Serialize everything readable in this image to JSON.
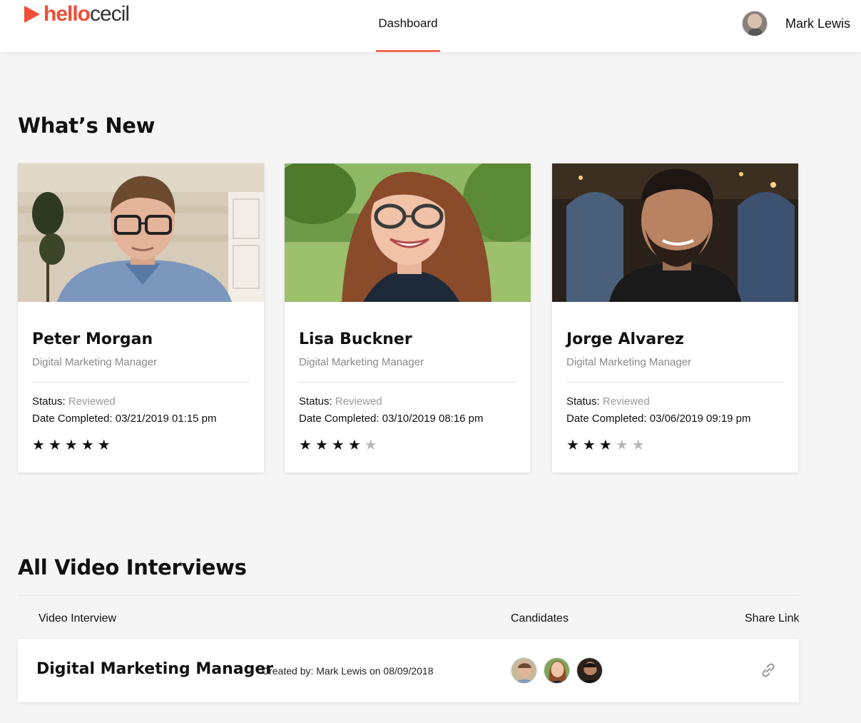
{
  "app": {
    "logo_hello": "hello",
    "logo_cecil": "cecil"
  },
  "nav": {
    "active_tab": "Dashboard"
  },
  "user": {
    "name": "Mark Lewis"
  },
  "whats_new": {
    "title": "What’s New",
    "status_label": "Status:",
    "date_label": "Date Completed:",
    "cards": [
      {
        "name": "Peter Morgan",
        "role": "Digital Marketing Manager",
        "status": "Reviewed",
        "date": "03/21/2019 01:15 pm",
        "rating": 5,
        "rating_max": 5
      },
      {
        "name": "Lisa Buckner",
        "role": "Digital Marketing Manager",
        "status": "Reviewed",
        "date": "03/10/2019 08:16 pm",
        "rating": 4,
        "rating_max": 5
      },
      {
        "name": "Jorge Alvarez",
        "role": "Digital Marketing Manager",
        "status": "Reviewed",
        "date": "03/06/2019 09:19 pm",
        "rating": 3,
        "rating_max": 5
      }
    ]
  },
  "interviews": {
    "title": "All Video Interviews",
    "columns": {
      "video": "Video Interview",
      "candidates": "Candidates",
      "share": "Share Link"
    },
    "rows": [
      {
        "title": "Digital Marketing Manager",
        "meta": "Created by: Mark Lewis on 08/09/2018",
        "candidate_count": 3
      }
    ]
  },
  "colors": {
    "accent": "#f04e37",
    "star_on": "#111111",
    "star_off": "#b8b8b8"
  }
}
